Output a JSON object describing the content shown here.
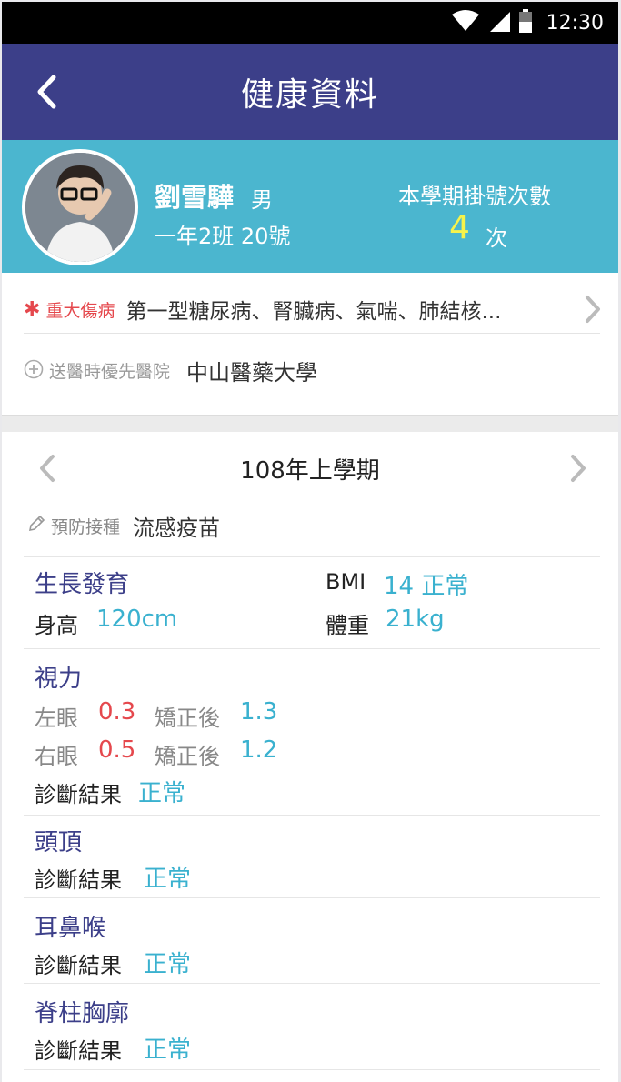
{
  "status_bar": {
    "time": "12:30"
  },
  "app_bar": {
    "title": "健康資料"
  },
  "profile": {
    "name": "劉雪驊",
    "gender": "男",
    "class_seat": "一年2班 20號",
    "registration_label": "本學期掛號次數",
    "registration_count": "4",
    "registration_unit": "次"
  },
  "info": {
    "major_illness_label": "重大傷病",
    "major_illness_value": "第一型糖尿病、腎臟病、氣喘、肺結核...",
    "preferred_hospital_label": "送醫時優先醫院",
    "preferred_hospital_value": "中山醫藥大學"
  },
  "semester": {
    "title": "108年上學期"
  },
  "vaccination": {
    "label": "預防接種",
    "value": "流感疫苗"
  },
  "growth": {
    "title": "生長發育",
    "bmi_label": "BMI",
    "bmi_value": "14 正常",
    "height_label": "身高",
    "height_value": "120cm",
    "weight_label": "體重",
    "weight_value": "21kg"
  },
  "vision": {
    "title": "視力",
    "left_label": "左眼",
    "left_value": "0.3",
    "left_corrected_label": "矯正後",
    "left_corrected_value": "1.3",
    "right_label": "右眼",
    "right_value": "0.5",
    "right_corrected_label": "矯正後",
    "right_corrected_value": "1.2",
    "diagnosis_label": "診斷結果",
    "diagnosis_value": "正常"
  },
  "sections": [
    {
      "title": "頭頂",
      "diagnosis_label": "診斷結果",
      "diagnosis_value": "正常"
    },
    {
      "title": "耳鼻喉",
      "diagnosis_label": "診斷結果",
      "diagnosis_value": "正常"
    },
    {
      "title": "脊柱胸廓",
      "diagnosis_label": "診斷結果",
      "diagnosis_value": "正常"
    }
  ],
  "colors": {
    "app_bar": "#3c3f89",
    "profile_band": "#4bb6cf",
    "value_blue": "#3ab1cf",
    "alert_red": "#e5484d",
    "count_yellow": "#f7f34a"
  }
}
